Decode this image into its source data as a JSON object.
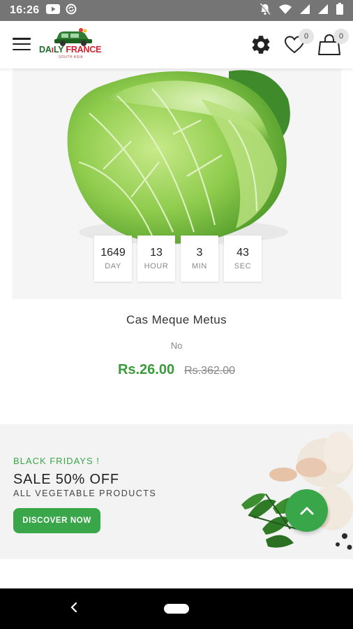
{
  "status_bar": {
    "time": "16:26",
    "icons_left": [
      "youtube-icon",
      "sync-icon"
    ],
    "icons_right": [
      "mute-icon",
      "wifi-icon",
      "signal-icon",
      "signal-icon",
      "battery-icon"
    ]
  },
  "app_bar": {
    "logo_text_green_1": "DA",
    "logo_text_green_2": "LY",
    "logo_text_red": " FRANCE",
    "logo_subtext": "SOUTH ASIA",
    "wishlist_count": "0",
    "cart_count": "0"
  },
  "product": {
    "countdown": [
      {
        "value": "1649",
        "label": "DAY"
      },
      {
        "value": "13",
        "label": "HOUR"
      },
      {
        "value": "3",
        "label": "MIN"
      },
      {
        "value": "43",
        "label": "SEC"
      }
    ],
    "name": "Cas Meque Metus",
    "subtitle": "No",
    "price": "Rs.26.00",
    "old_price": "Rs.362.00"
  },
  "promo": {
    "eyebrow": "BLACK FRIDAYS !",
    "title": "SALE 50% OFF",
    "subtitle": "ALL VEGETABLE PRODUCTS",
    "button_label": "DISCOVER NOW"
  },
  "colors": {
    "accent": "#3aa64a",
    "price": "#3a9b3a",
    "status_bar": "#757575"
  }
}
